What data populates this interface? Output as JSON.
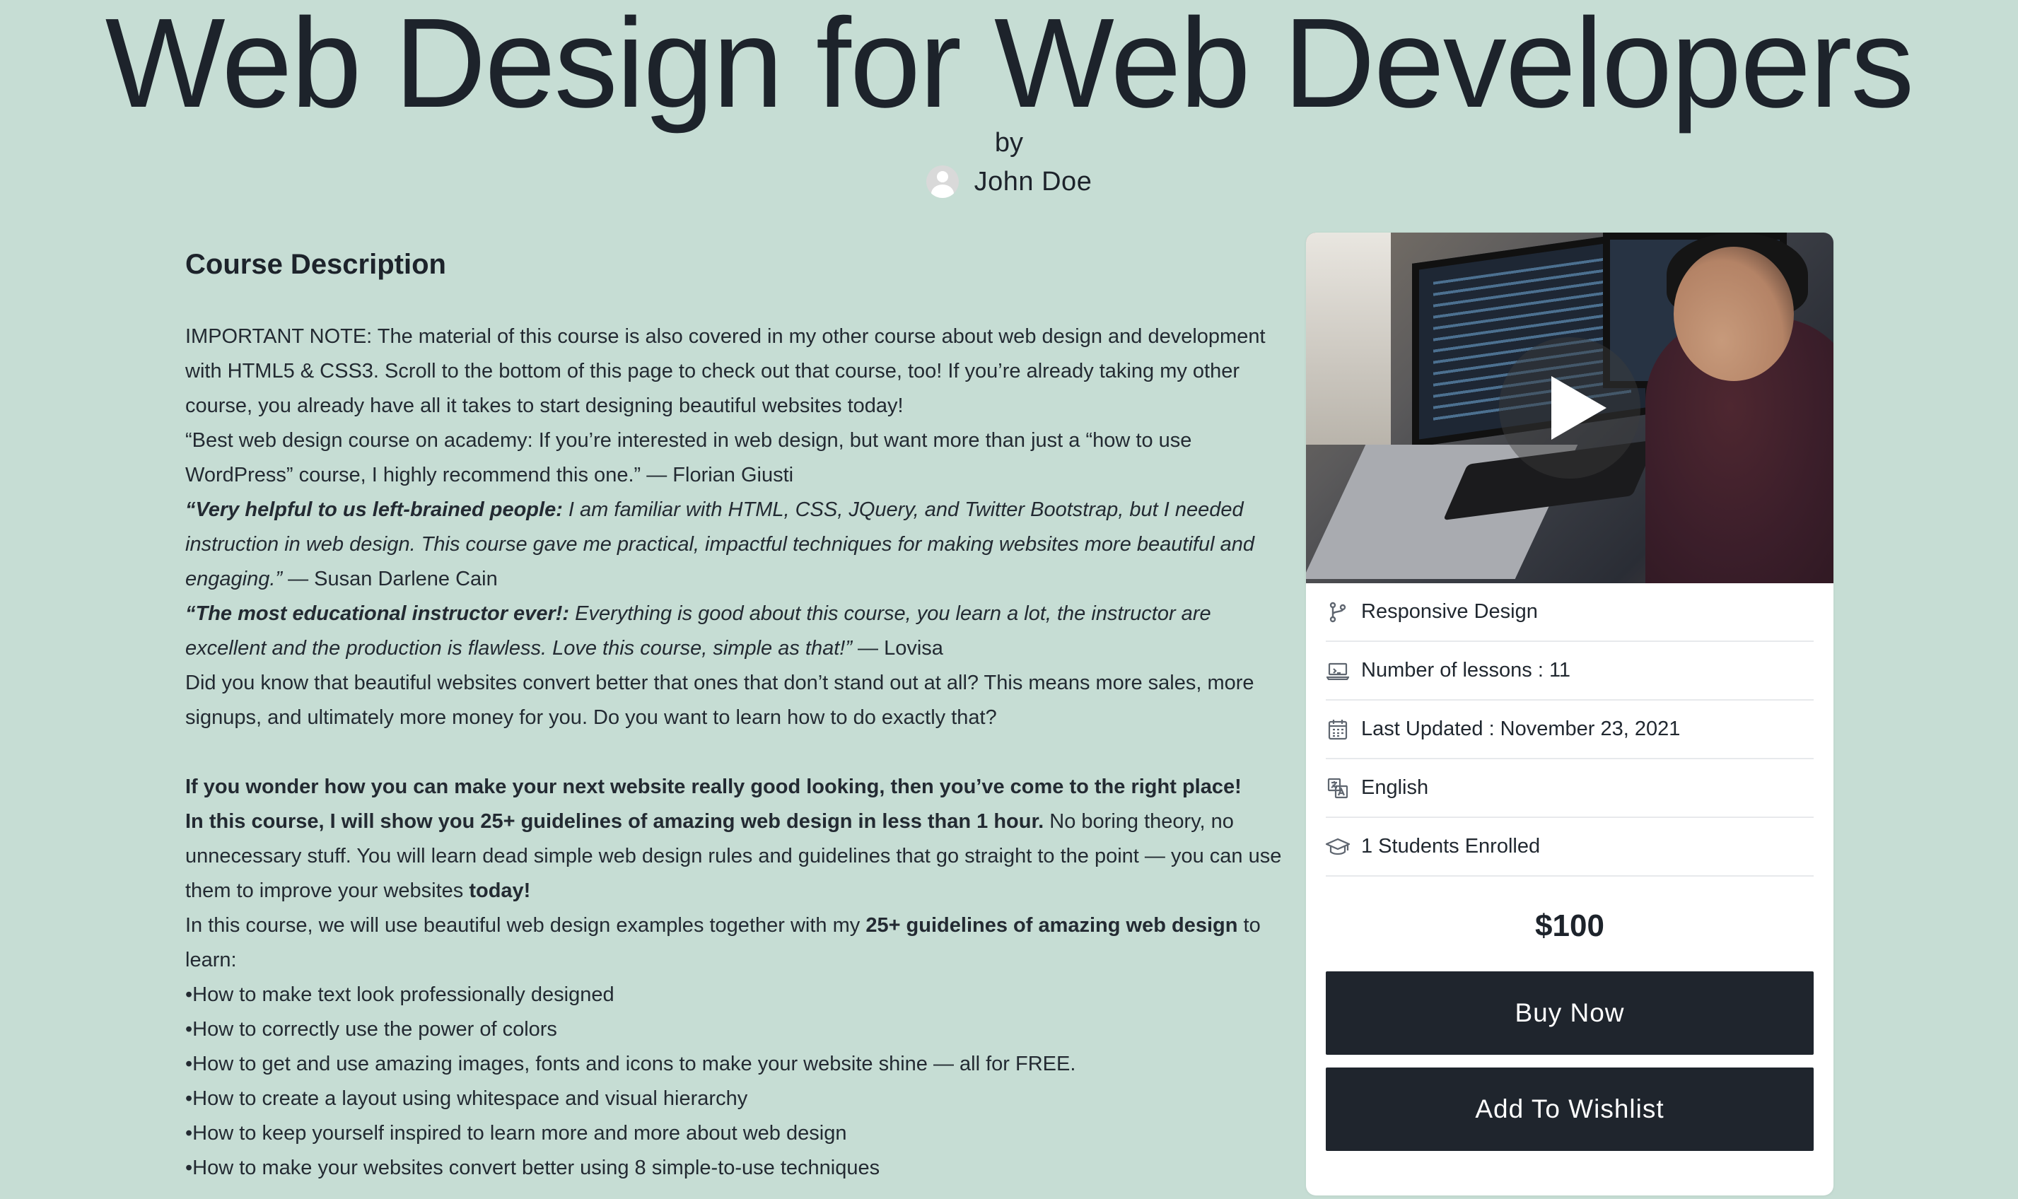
{
  "header": {
    "title": "Web Design for Web Developers",
    "by": "by",
    "author": "John Doe"
  },
  "description": {
    "heading": "Course Description",
    "p1": "IMPORTANT NOTE: The material of this course is also covered in my other course about web design and development with HTML5 & CSS3. Scroll to the bottom of this page to check out that course, too! If you’re already taking my other course, you already have all it takes to start designing beautiful websites today!",
    "q1_text": "“Best web design course on academy: If you’re interested in web design, but want more than just a “how to use WordPress” course, I highly recommend this one.”",
    "q1_author": "— Florian Giusti",
    "q2_bold": "“Very helpful to us left-brained people:",
    "q2_text": " I am familiar with HTML, CSS, JQuery, and Twitter Bootstrap, but I needed instruction in web design. This course gave me practical, impactful techniques for making websites more beautiful and engaging.”",
    "q2_author": " — Susan Darlene Cain",
    "q3_bold": "“The most educational instructor ever!:",
    "q3_text": " Everything is good about this course, you learn a lot, the instructor are excellent and the production is flawless. Love this course, simple as that!”",
    "q3_author": " — Lovisa",
    "p2": "Did you know that beautiful websites convert better that ones that don’t stand out at all? This means more sales, more signups, and ultimately more money for you. Do you want to learn how to do exactly that?",
    "bold1": "If you wonder how you can make your next website really good looking, then you’ve come to the right place!",
    "bold2": "In this course, I will show you 25+ guidelines of amazing web design in less than 1 hour.",
    "p3": " No boring theory, no unnecessary stuff. You will learn dead simple web design rules and guidelines that go straight to the point — you can use them to improve your websites ",
    "p3_bold": "today!",
    "p4_start": "In this course, we will use beautiful web design examples together with my ",
    "p4_bold": "25+ guidelines of amazing web design",
    "p4_end": " to learn:",
    "bullets": [
      "How to make text look professionally designed",
      "How to correctly use the power of colors",
      "How to get and use amazing images, fonts and icons to make your website shine — all for FREE.",
      "How to create a layout using whitespace and visual hierarchy",
      "How to keep yourself inspired to learn more and more about web design",
      "How to make your websites convert better using 8 simple-to-use techniques"
    ]
  },
  "card": {
    "features": [
      {
        "icon": "branch-icon",
        "label": "Responsive Design"
      },
      {
        "icon": "laptop-icon",
        "label": "Number of lessons : 11"
      },
      {
        "icon": "calendar-icon",
        "label": "Last Updated : November 23, 2021"
      },
      {
        "icon": "translate-icon",
        "label": "English"
      },
      {
        "icon": "graduation-cap-icon",
        "label": "1 Students Enrolled"
      }
    ],
    "price": "$100",
    "buy_label": "Buy Now",
    "wishlist_label": "Add To Wishlist"
  },
  "colors": {
    "background": "#c6ddd4",
    "button": "#1f252d",
    "text": "#1d232b"
  }
}
